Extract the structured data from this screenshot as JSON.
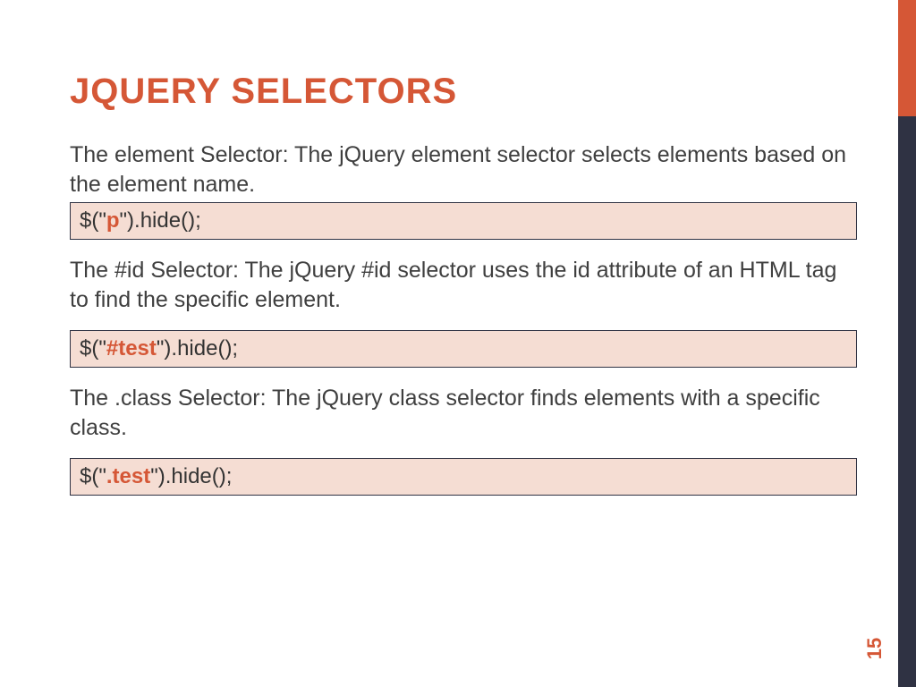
{
  "title": "JQUERY SELECTORS",
  "sections": [
    {
      "text": "The element Selector: The jQuery element selector selects elements based on the element name.",
      "code_prefix": "$(\"",
      "code_hl": "p",
      "code_suffix": "\").hide();"
    },
    {
      "text": "The #id Selector: The jQuery #id selector uses the id attribute of an HTML tag to find the specific element.",
      "code_prefix": "$(\"",
      "code_hl": "#test",
      "code_suffix": "\").hide();"
    },
    {
      "text": "The .class Selector: The jQuery class selector finds elements with a specific class.",
      "code_prefix": "$(\"",
      "code_hl": ".test",
      "code_suffix": "\").hide();"
    }
  ],
  "page_number": "15"
}
